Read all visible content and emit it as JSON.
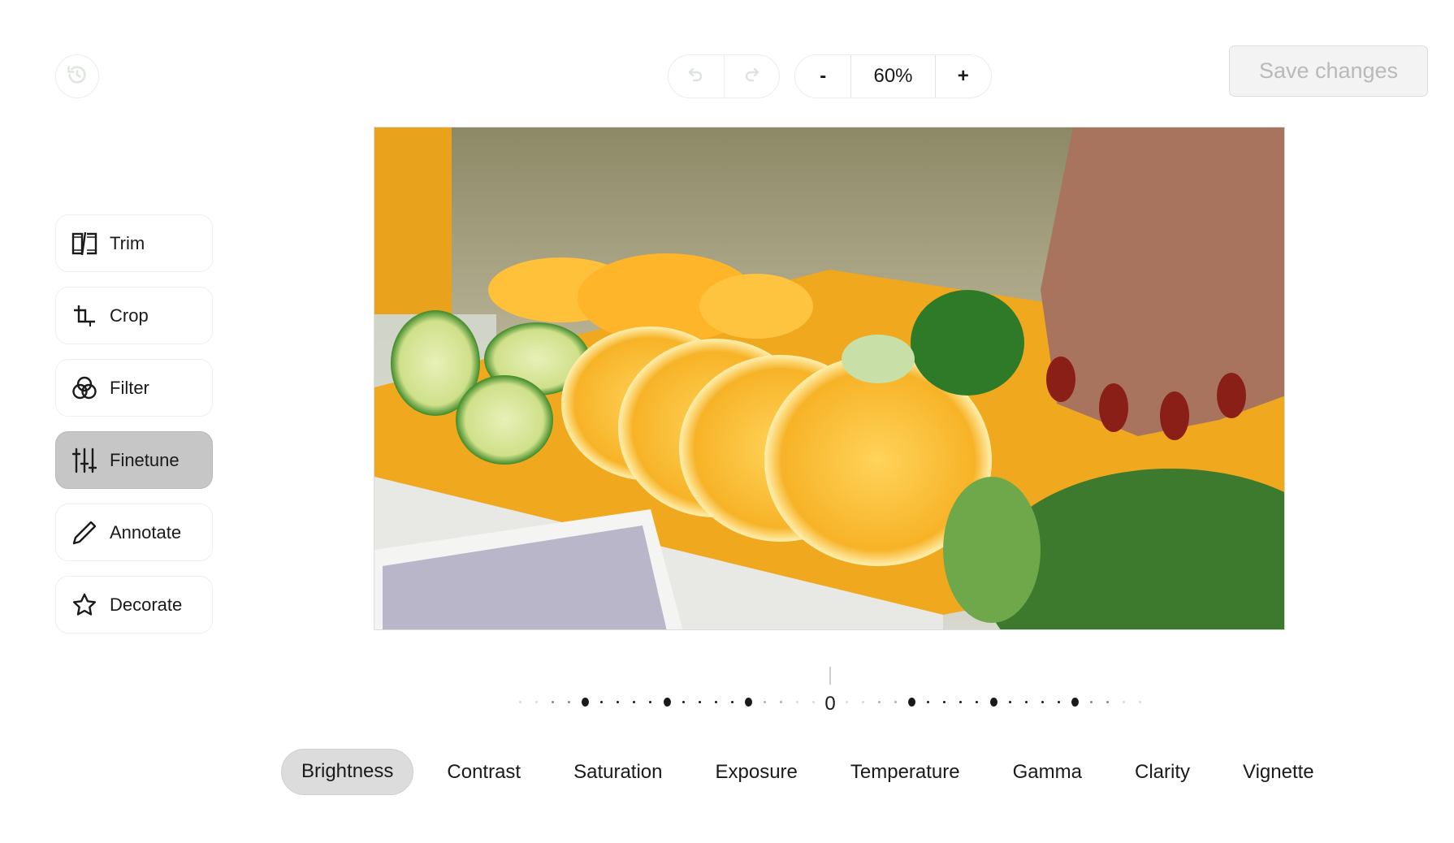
{
  "header": {
    "history_icon": "history-icon",
    "undo_icon": "undo-icon",
    "redo_icon": "redo-icon",
    "zoom_out_label": "-",
    "zoom_level": "60%",
    "zoom_in_label": "+",
    "save_label": "Save changes"
  },
  "sidebar": {
    "items": [
      {
        "label": "Trim",
        "icon": "film-trim-icon",
        "active": false
      },
      {
        "label": "Crop",
        "icon": "crop-icon",
        "active": false
      },
      {
        "label": "Filter",
        "icon": "filter-circles-icon",
        "active": false
      },
      {
        "label": "Finetune",
        "icon": "sliders-icon",
        "active": true
      },
      {
        "label": "Annotate",
        "icon": "pencil-icon",
        "active": false
      },
      {
        "label": "Decorate",
        "icon": "star-icon",
        "active": false
      }
    ]
  },
  "canvas": {
    "image_description": "Hands slicing oranges, limes and cucumber on a yellow tray"
  },
  "slider": {
    "value": "0",
    "min": -100,
    "max": 100,
    "current": 0
  },
  "tabs": [
    {
      "label": "Brightness",
      "active": true
    },
    {
      "label": "Contrast",
      "active": false
    },
    {
      "label": "Saturation",
      "active": false
    },
    {
      "label": "Exposure",
      "active": false
    },
    {
      "label": "Temperature",
      "active": false
    },
    {
      "label": "Gamma",
      "active": false
    },
    {
      "label": "Clarity",
      "active": false
    },
    {
      "label": "Vignette",
      "active": false
    }
  ],
  "colors": {
    "active_sidebar_bg": "#c6c6c6",
    "active_tab_bg": "#dcdcdc",
    "disabled_text": "#b9b9b9",
    "text": "#1a1a1a"
  }
}
